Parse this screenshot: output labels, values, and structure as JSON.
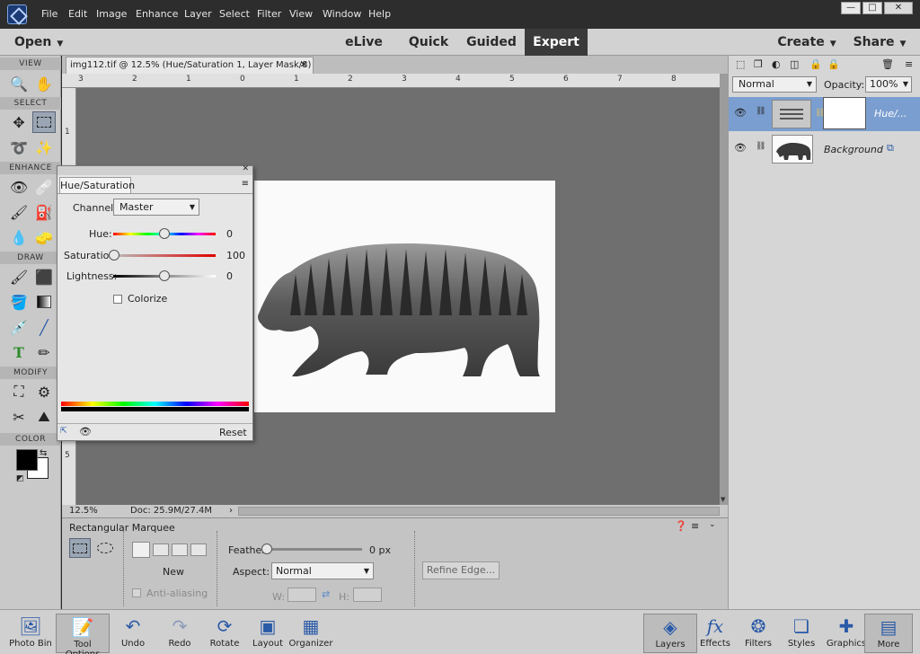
{
  "menu": [
    "File",
    "Edit",
    "Image",
    "Enhance",
    "Layer",
    "Select",
    "Filter",
    "View",
    "Window",
    "Help"
  ],
  "window_controls": {
    "minimize": "—",
    "maximize": "□",
    "close": "✕"
  },
  "modebar": {
    "open": "Open",
    "modes": [
      "eLive",
      "Quick",
      "Guided",
      "Expert"
    ],
    "active_mode": "Expert",
    "create": "Create",
    "share": "Share"
  },
  "toolbox": {
    "sections": [
      "VIEW",
      "SELECT",
      "ENHANCE",
      "DRAW",
      "MODIFY",
      "COLOR"
    ]
  },
  "document": {
    "tab_title": "img112.tif @ 12.5% (Hue/Saturation 1, Layer Mask/8) *",
    "zoom": "12.5%",
    "doc_size": "Doc: 25.9M/27.4M",
    "ruler_top": [
      "3",
      "2",
      "1",
      "0",
      "1",
      "2",
      "3",
      "4",
      "5",
      "6",
      "7",
      "8"
    ],
    "ruler_left": [
      "1",
      "5"
    ]
  },
  "huesat": {
    "title": "Hue/Saturation",
    "channel_label": "Channel:",
    "channel_value": "Master",
    "hue_label": "Hue:",
    "hue_value": "0",
    "saturation_label": "Saturation:",
    "saturation_value": "100",
    "lightness_label": "Lightness:",
    "lightness_value": "0",
    "colorize_label": "Colorize",
    "reset_label": "Reset"
  },
  "options": {
    "tool_name": "Rectangular Marquee",
    "new_label": "New",
    "antialias_label": "Anti-aliasing",
    "feather_label": "Feather:",
    "feather_value": "0 px",
    "aspect_label": "Aspect:",
    "aspect_value": "Normal",
    "w_label": "W:",
    "h_label": "H:",
    "refine_edge_label": "Refine Edge..."
  },
  "layers_panel": {
    "blend_mode": "Normal",
    "opacity_label": "Opacity:",
    "opacity_value": "100%",
    "layers": [
      {
        "name": "Hue/...",
        "selected": true
      },
      {
        "name": "Background",
        "selected": false
      }
    ]
  },
  "bottom_left": [
    "Photo Bin",
    "Tool Options",
    "Undo",
    "Redo",
    "Rotate",
    "Layout",
    "Organizer"
  ],
  "bottom_right": [
    "Layers",
    "Effects",
    "Filters",
    "Styles",
    "Graphics",
    "More"
  ],
  "colors": {
    "accent": "#7b9ed0",
    "dark_bar": "#2d2d2d",
    "canvas": "#6f6f6f",
    "icon_blue": "#2a5aa8"
  }
}
